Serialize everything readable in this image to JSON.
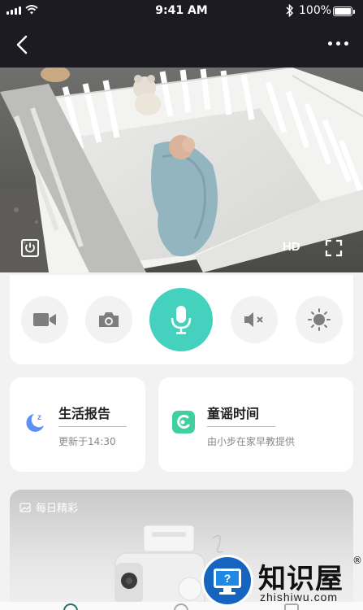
{
  "status_bar": {
    "time": "9:41 AM",
    "battery": "100%",
    "icons": [
      "signal-icon",
      "wifi-icon",
      "bluetooth-icon",
      "battery-icon"
    ]
  },
  "nav": {
    "back_icon": "chevron-left-icon",
    "more_icon": "more-dots-icon"
  },
  "video": {
    "quality_label": "HD",
    "icons": [
      "power-icon",
      "fullscreen-icon"
    ]
  },
  "controls": [
    {
      "name": "record-video",
      "icon": "video-camera-icon"
    },
    {
      "name": "snapshot",
      "icon": "camera-icon"
    },
    {
      "name": "talk",
      "icon": "microphone-icon",
      "accent": "#44d1bd"
    },
    {
      "name": "mute",
      "icon": "speaker-muted-icon"
    },
    {
      "name": "night-light",
      "icon": "brightness-icon"
    }
  ],
  "cards": {
    "life_report": {
      "title": "生活报告",
      "subtitle": "更新于14:30",
      "icon": "moon-sleep-icon",
      "icon_color": "#5c8ff7"
    },
    "nursery_rhymes": {
      "title": "童谣时间",
      "subtitle": "由小步在家早教提供",
      "icon": "app-logo-icon",
      "icon_color": "#3fcfa0"
    }
  },
  "daily": {
    "label": "每日精彩",
    "icon": "image-icon"
  },
  "watermark": {
    "text": "知识屋",
    "url": "zhishiwu.com",
    "reg": "®"
  }
}
